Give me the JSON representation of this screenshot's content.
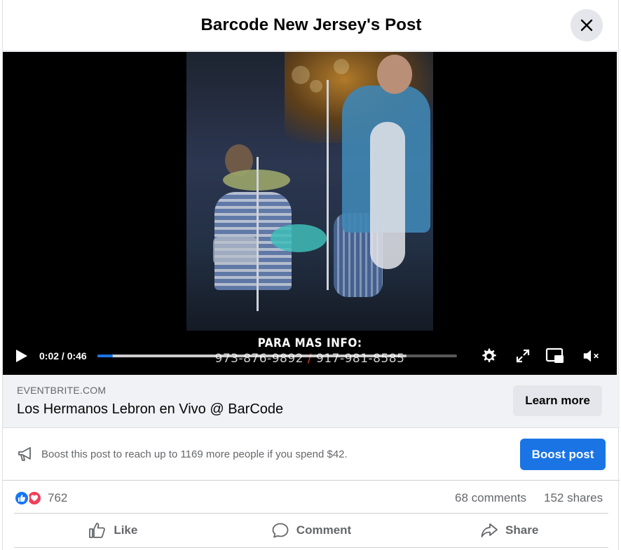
{
  "header": {
    "title": "Barcode New Jersey's Post"
  },
  "video": {
    "overlay_line1": "PARA MAS INFO:",
    "overlay_phone1": "973-876-9892",
    "overlay_sep": " / ",
    "overlay_phone2": "917-981-8585",
    "time_display": "0:02 / 0:46",
    "current_time": "0:02",
    "duration": "0:46",
    "progress_fraction": 0.043,
    "buffered_fraction": 0.86,
    "accent_color": "#1b74e4"
  },
  "link": {
    "domain": "EVENTBRITE.COM",
    "title": "Los Hermanos Lebron en Vivo @ BarCode",
    "button_label": "Learn more"
  },
  "boost": {
    "text": "Boost this post to reach up to 1169 more people if you spend $42.",
    "button_label": "Boost post"
  },
  "stats": {
    "reaction_count": "762",
    "comments": "68 comments",
    "shares": "152 shares"
  },
  "actions": {
    "like": "Like",
    "comment": "Comment",
    "share": "Share"
  },
  "icons": {
    "close": "close-icon",
    "play": "play-icon",
    "settings": "gear-icon",
    "fullscreen": "expand-icon",
    "pip": "picture-in-picture-icon",
    "mute": "volume-muted-icon",
    "megaphone": "megaphone-icon",
    "like": "thumbs-up-icon",
    "comment": "comment-bubble-icon",
    "share": "share-arrow-icon"
  }
}
